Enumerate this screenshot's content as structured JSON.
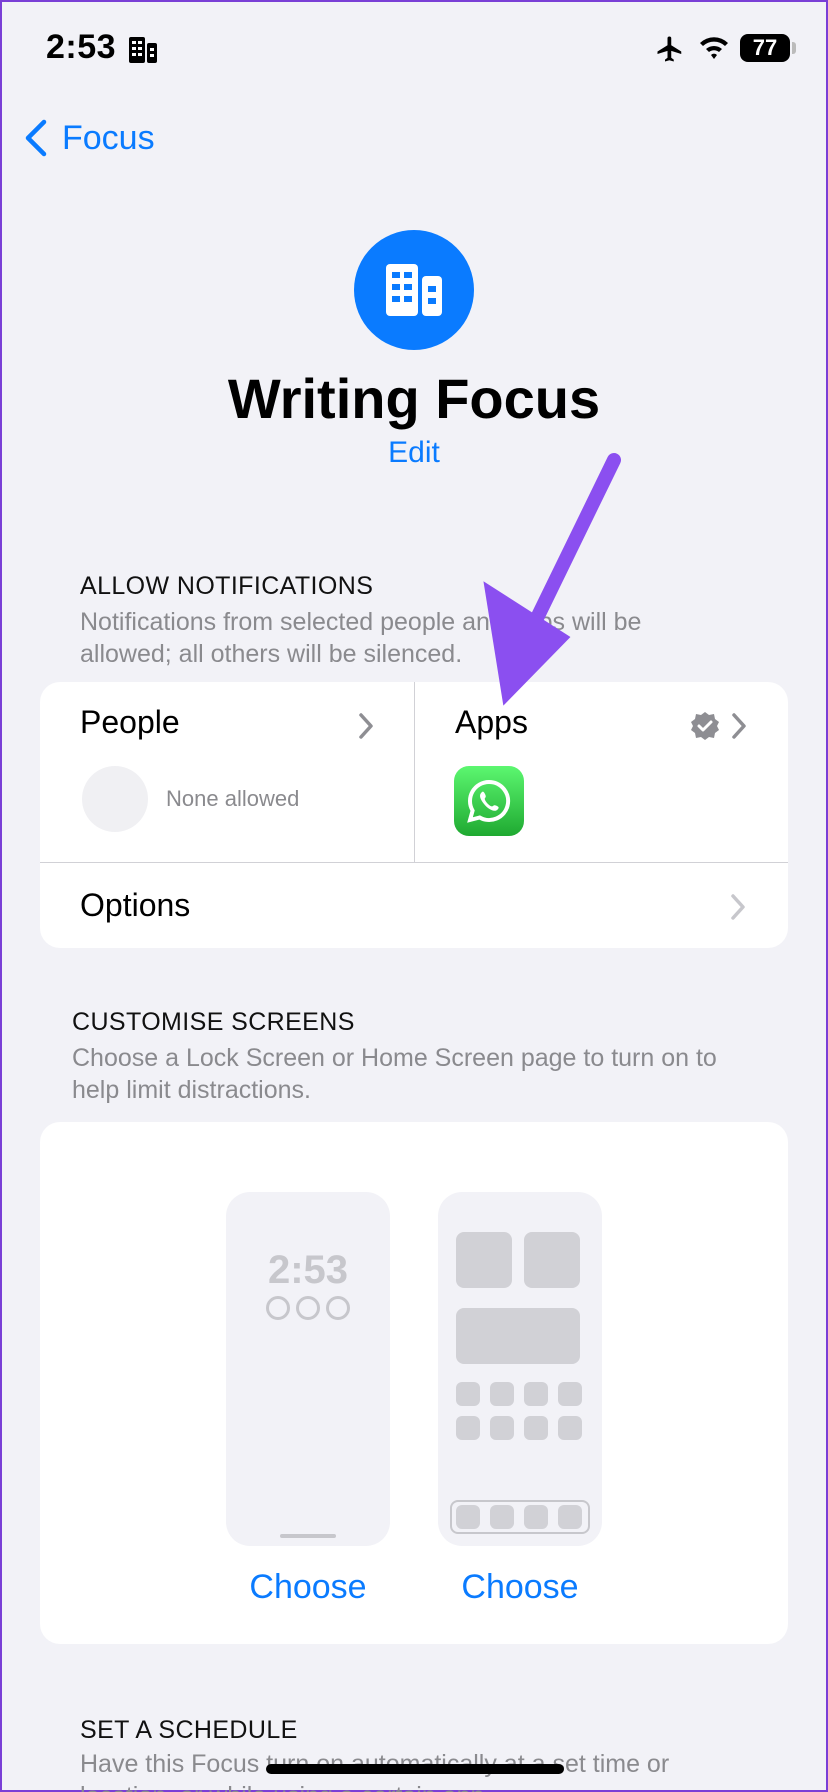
{
  "status": {
    "time": "2:53",
    "battery": "77"
  },
  "nav": {
    "back_label": "Focus"
  },
  "header": {
    "title": "Writing Focus",
    "edit_label": "Edit"
  },
  "allow": {
    "heading": "ALLOW NOTIFICATIONS",
    "description": "Notifications from selected people and apps will be allowed; all others will be silenced.",
    "people_label": "People",
    "people_value": "None allowed",
    "apps_label": "Apps",
    "options_label": "Options"
  },
  "customise": {
    "heading": "CUSTOMISE SCREENS",
    "description": "Choose a Lock Screen or Home Screen page to turn on to help limit distractions.",
    "lock_time": "2:53",
    "choose_lock": "Choose",
    "choose_home": "Choose"
  },
  "schedule": {
    "heading": "SET A SCHEDULE",
    "description": "Have this Focus turn on automatically at a set time or location, or while using a certain app."
  },
  "colors": {
    "accent": "#0a7bff",
    "background": "#f2f2f7",
    "arrow": "#8b4ff0",
    "whatsapp": "#25d366"
  }
}
